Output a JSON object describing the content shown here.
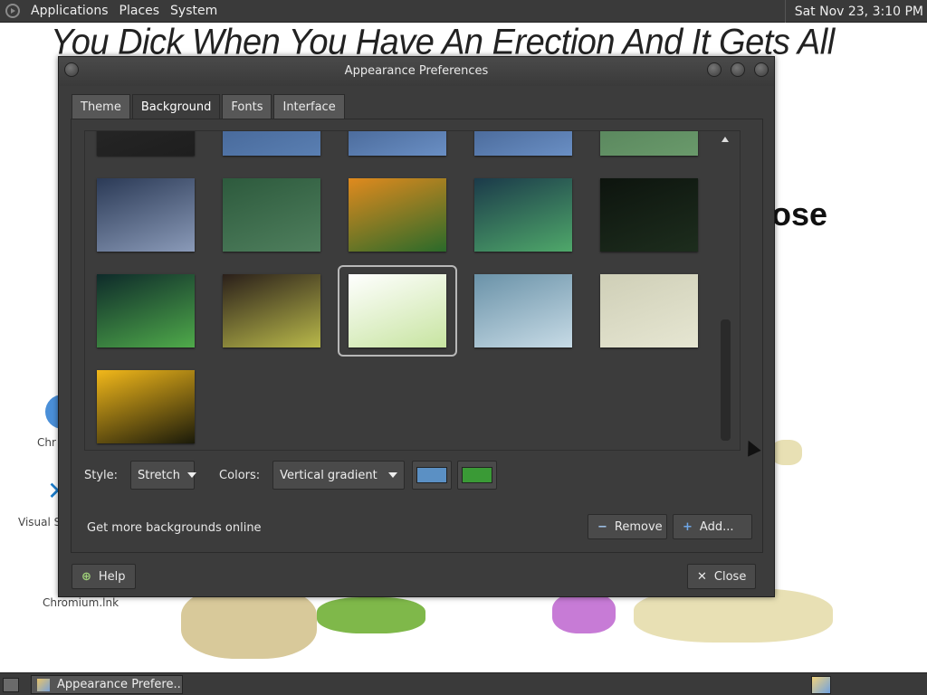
{
  "top_panel": {
    "menus": [
      "Applications",
      "Places",
      "System"
    ],
    "clock": "Sat Nov 23,  3:10 PM"
  },
  "desktop": {
    "background_text": "You Dick When You Have An Erection And It Gets All",
    "background_text_right": "ose",
    "icons": [
      {
        "label": "Chr",
        "icon": "chromium-icon"
      },
      {
        "label": "Visual S",
        "icon": "visual-studio-code-icon"
      },
      {
        "label": "Chromium.lnk",
        "icon": "chromium-shortcut-icon"
      }
    ]
  },
  "window": {
    "title": "Appearance Preferences",
    "tabs": [
      {
        "label": "Theme",
        "active": false
      },
      {
        "label": "Background",
        "active": true
      },
      {
        "label": "Fonts",
        "active": false
      },
      {
        "label": "Interface",
        "active": false
      }
    ],
    "gallery": {
      "selected_index": 7,
      "thumbnails": [
        {
          "name": "dark-gray",
          "colors": [
            "#2a2a2a",
            "#1e1e1e"
          ]
        },
        {
          "name": "blue-crystals-partial",
          "colors": [
            "#3b5a8a",
            "#5a7fb2"
          ]
        },
        {
          "name": "blue-crystals-partial-2",
          "colors": [
            "#34507d",
            "#6a8fc4"
          ]
        },
        {
          "name": "blue-crystals-partial-3",
          "colors": [
            "#34507d",
            "#6a8fc4"
          ]
        },
        {
          "name": "green-field-partial",
          "colors": [
            "#4f7a55",
            "#6a9a6b"
          ]
        },
        {
          "name": "stormy-sea",
          "colors": [
            "#2b3a56",
            "#8a9ab8"
          ]
        },
        {
          "name": "green-curtain",
          "colors": [
            "#2d5a3d",
            "#4f7f5d"
          ]
        },
        {
          "name": "dandelion-orange",
          "colors": [
            "#e08a1e",
            "#2a6a2a"
          ]
        },
        {
          "name": "aurora-blue",
          "colors": [
            "#1b3a4a",
            "#4fa86a"
          ]
        },
        {
          "name": "dark-forest",
          "colors": [
            "#0d140e",
            "#1d2d1d"
          ]
        },
        {
          "name": "aurora-green",
          "colors": [
            "#0e2a2a",
            "#4faa4a"
          ]
        },
        {
          "name": "aurora-yellow",
          "colors": [
            "#2a1f1a",
            "#b9b94a"
          ]
        },
        {
          "name": "document-preview",
          "colors": [
            "#ffffff",
            "#c7e4a0"
          ]
        },
        {
          "name": "blue-swirl",
          "colors": [
            "#6a92a8",
            "#c7dbe6"
          ]
        },
        {
          "name": "beige-sand",
          "colors": [
            "#cfcfb7",
            "#e6e6d2"
          ]
        },
        {
          "name": "yellow-flower",
          "colors": [
            "#f2b81a",
            "#1a1a0a"
          ]
        }
      ]
    },
    "style_label": "Style:",
    "style_value": "Stretch",
    "colors_label": "Colors:",
    "colors_value": "Vertical gradient",
    "primary_color": "#5b90c4",
    "secondary_color": "#3a9a36",
    "get_more_label": "Get more backgrounds online",
    "remove_label": "Remove",
    "add_label": "Add...",
    "help_label": "Help",
    "close_label": "Close"
  },
  "taskbar": {
    "task_label": "Appearance Prefere..."
  }
}
